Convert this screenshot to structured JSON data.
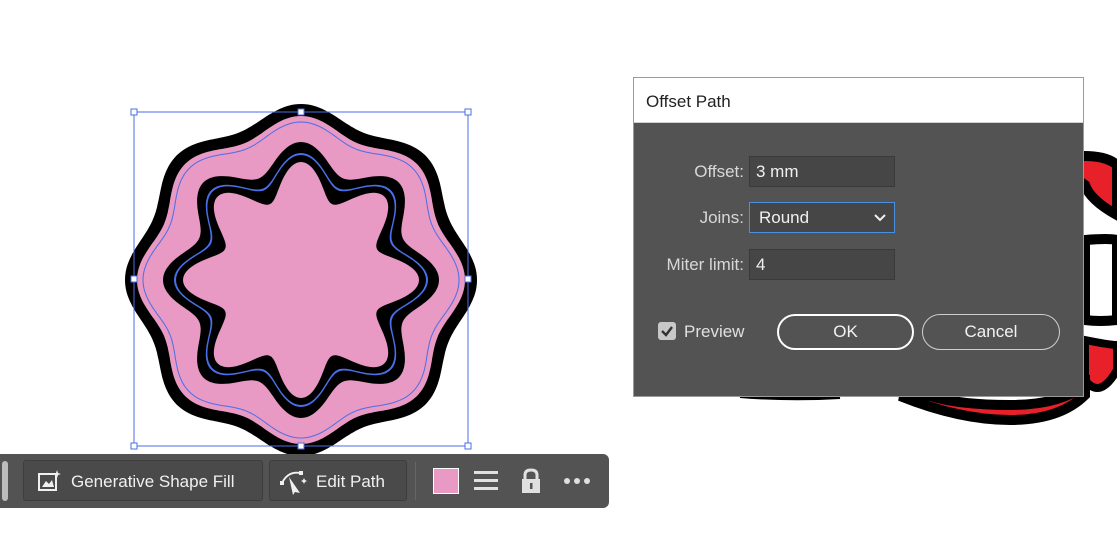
{
  "dialog": {
    "title": "Offset Path",
    "offset_label": "Offset:",
    "offset_value": "3 mm",
    "joins_label": "Joins:",
    "joins_value": "Round",
    "miter_label": "Miter limit:",
    "miter_value": "4",
    "preview_label": "Preview",
    "preview_checked": true,
    "ok_label": "OK",
    "cancel_label": "Cancel"
  },
  "toolbar": {
    "generative_label": "Generative Shape Fill",
    "edit_path_label": "Edit Path",
    "fill_color": "#e899c4"
  },
  "colors": {
    "shape_fill": "#e899c4",
    "stroke": "#000000",
    "selection": "#4a6fe8",
    "red_shape": "#e8202a"
  },
  "icons": [
    "generative-shape-fill-icon",
    "edit-path-icon",
    "fill-swatch",
    "align-lines-icon",
    "lock-icon",
    "more-icon",
    "chevron-down-icon",
    "checkmark-icon"
  ]
}
